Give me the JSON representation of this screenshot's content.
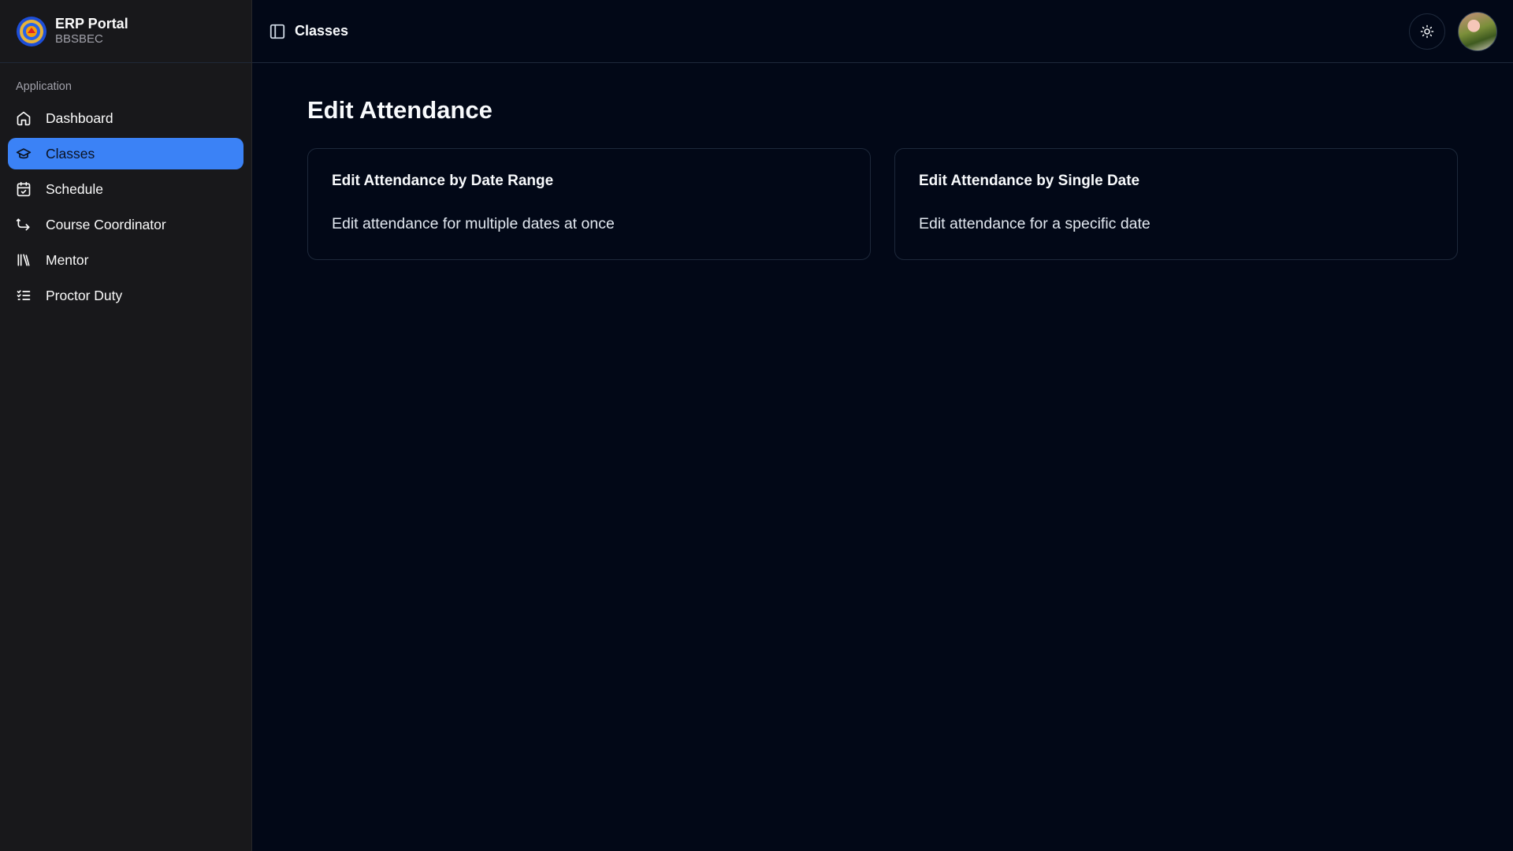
{
  "brand": {
    "title": "ERP Portal",
    "subtitle": "BBSBEC"
  },
  "sidebar": {
    "group_label": "Application",
    "items": [
      {
        "label": "Dashboard",
        "icon": "home-icon",
        "active": false
      },
      {
        "label": "Classes",
        "icon": "graduation-cap-icon",
        "active": true
      },
      {
        "label": "Schedule",
        "icon": "calendar-check-icon",
        "active": false
      },
      {
        "label": "Course Coordinator",
        "icon": "route-icon",
        "active": false
      },
      {
        "label": "Mentor",
        "icon": "library-icon",
        "active": false
      },
      {
        "label": "Proctor Duty",
        "icon": "list-checks-icon",
        "active": false
      }
    ]
  },
  "topbar": {
    "title": "Classes"
  },
  "page": {
    "title": "Edit Attendance",
    "cards": [
      {
        "title": "Edit Attendance by Date Range",
        "description": "Edit attendance for multiple dates at once"
      },
      {
        "title": "Edit Attendance by Single Date",
        "description": "Edit attendance for a specific date"
      }
    ]
  },
  "colors": {
    "accent": "#3b82f6",
    "background": "#020817",
    "sidebar": "#18181b"
  }
}
